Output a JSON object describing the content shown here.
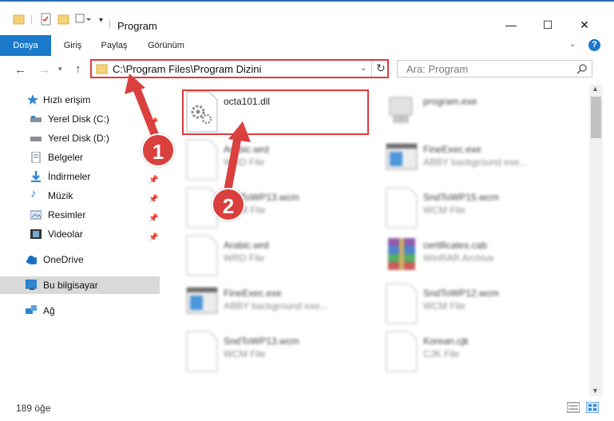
{
  "window": {
    "title": "Program",
    "minimize_glyph": "—",
    "maximize_glyph": "☐",
    "close_glyph": "✕"
  },
  "ribbon": {
    "tabs": [
      "Dosya",
      "Giriş",
      "Paylaş",
      "Görünüm"
    ],
    "help_glyph": "?",
    "accent_color": "#1979ca"
  },
  "address": {
    "path": "C:\\Program Files\\Program Dizini",
    "search_placeholder": "Ara: Program"
  },
  "sidebar": {
    "items": [
      {
        "label": "Hızlı erişim",
        "icon": "star-icon"
      },
      {
        "label": "Yerel Disk (C:)",
        "icon": "drive-icon"
      },
      {
        "label": "Yerel Disk (D:)",
        "icon": "drive-icon"
      },
      {
        "label": "Belgeler",
        "icon": "document-icon"
      },
      {
        "label": "İndirmeler",
        "icon": "download-icon"
      },
      {
        "label": "Müzik",
        "icon": "music-icon"
      },
      {
        "label": "Resimler",
        "icon": "pictures-icon"
      },
      {
        "label": "Videolar",
        "icon": "video-icon"
      },
      {
        "label": "OneDrive",
        "icon": "cloud-icon"
      },
      {
        "label": "Bu bilgisayar",
        "icon": "computer-icon"
      },
      {
        "label": "Ağ",
        "icon": "network-icon"
      }
    ]
  },
  "files": [
    {
      "name": "octa101.dll",
      "type": "",
      "icon": "dll-gear-icon"
    },
    {
      "name": "program.exe",
      "type": "",
      "icon": "exe-icon"
    },
    {
      "name": "Arabic.wrd",
      "type": "WRD File",
      "icon": "file-icon"
    },
    {
      "name": "FineExec.exe",
      "type": "ABBY background exe...",
      "icon": "exe-window-icon"
    },
    {
      "name": "SndToWP13.wcm",
      "type": "WCM File",
      "icon": "file-icon"
    },
    {
      "name": "SndToWP15.wcm",
      "type": "WCM File",
      "icon": "file-icon"
    },
    {
      "name": "Arabic.wrd",
      "type": "WRD File",
      "icon": "file-icon"
    },
    {
      "name": "certificates.cab",
      "type": "WinRAR Archive",
      "icon": "archive-icon"
    },
    {
      "name": "FineExec.exe",
      "type": "ABBY background exe...",
      "icon": "exe-window-icon"
    },
    {
      "name": "SndToWP12.wcm",
      "type": "WCM File",
      "icon": "file-icon"
    },
    {
      "name": "SndToWP13.wcm",
      "type": "WCM File",
      "icon": "file-icon"
    },
    {
      "name": "Korean.cjk",
      "type": "CJK File",
      "icon": "file-icon"
    }
  ],
  "status": {
    "item_count": "189 öğe"
  },
  "annotations": {
    "badge1": "1",
    "badge2": "2",
    "arrow_color": "#d9403e"
  }
}
